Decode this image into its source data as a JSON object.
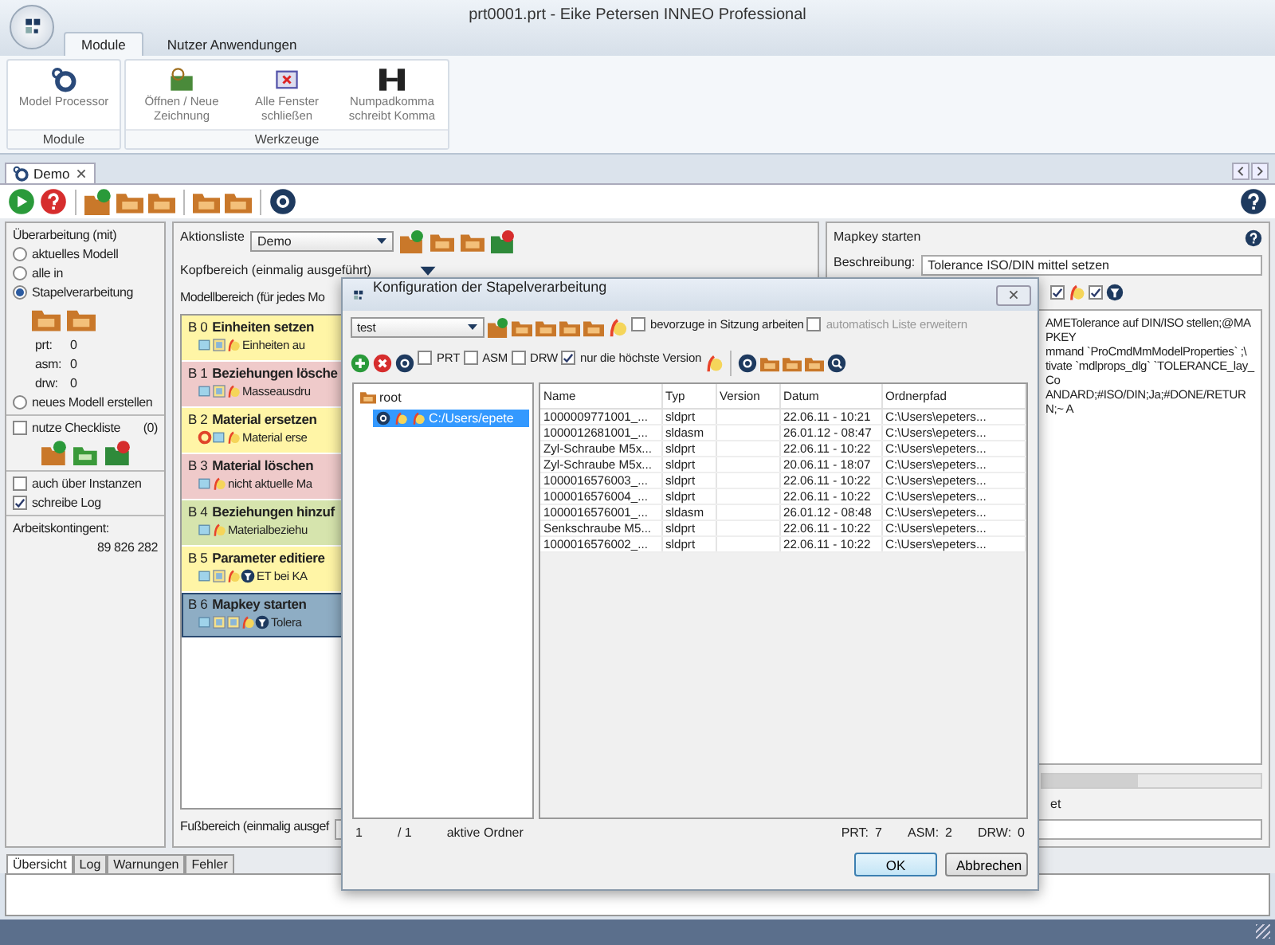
{
  "window": {
    "title": "prt0001.prt - Eike Petersen INNEO Professional"
  },
  "ribbon": {
    "tabs": [
      {
        "label": "Module",
        "selected": true
      },
      {
        "label": "Nutzer Anwendungen",
        "selected": false
      }
    ],
    "groups": [
      {
        "label": "Module",
        "buttons": [
          {
            "label": "Model Processor"
          }
        ]
      },
      {
        "label": "Werkzeuge",
        "buttons": [
          {
            "label": "Öffnen / Neue Zeichnung"
          },
          {
            "label": "Alle Fenster schließen"
          },
          {
            "label": "Numpadkomma schreibt Komma"
          }
        ]
      }
    ]
  },
  "document_tabs": [
    {
      "label": "Demo",
      "selected": true
    }
  ],
  "left_panel": {
    "heading": "Überarbeitung (mit)",
    "options": [
      {
        "label": "aktuelles Modell",
        "selected": false
      },
      {
        "label": "alle in",
        "selected": false
      },
      {
        "label": "Stapelverarbeitung",
        "selected": true
      },
      {
        "label": "neues Modell erstellen",
        "selected": false
      }
    ],
    "counts": [
      {
        "label": "prt:",
        "value": "0"
      },
      {
        "label": "asm:",
        "value": "0"
      },
      {
        "label": "drw:",
        "value": "0"
      }
    ],
    "checklist": {
      "label": "nutze Checkliste",
      "checked": false,
      "count": "(0)"
    },
    "checks": [
      {
        "label": "auch über Instanzen",
        "checked": false
      },
      {
        "label": "schreibe Log",
        "checked": true
      }
    ],
    "quota": {
      "label": "Arbeitskontingent:",
      "value": "89 826 282"
    }
  },
  "center": {
    "action_list": {
      "label": "Aktionsliste",
      "value": "Demo"
    },
    "header_section": "Kopfbereich (einmalig ausgeführt)",
    "model_section": "Modellbereich (für jedes Mo",
    "blocks": [
      {
        "id": "B 0",
        "title": "Einheiten setzen",
        "action": "Einheiten au",
        "color": "#fff5a6",
        "selected": false
      },
      {
        "id": "B 1",
        "title": "Beziehungen lösche",
        "action": "Masseausdru",
        "color": "#efcaca",
        "selected": false
      },
      {
        "id": "B 2",
        "title": "Material ersetzen",
        "action": "Material erse",
        "color": "#fff5a6",
        "selected": false
      },
      {
        "id": "B 3",
        "title": "Material löschen",
        "action": "nicht aktuelle Ma",
        "color": "#efcaca",
        "selected": false
      },
      {
        "id": "B 4",
        "title": "Beziehungen hinzuf",
        "action": "Materialbeziehu",
        "color": "#d6e4ad",
        "selected": false
      },
      {
        "id": "B 5",
        "title": "Parameter editiere",
        "action": "ET bei KA",
        "color": "#fff5a6",
        "selected": false
      },
      {
        "id": "B 6",
        "title": "Mapkey starten",
        "action": "Tolera",
        "color": "#8eadc4",
        "selected": true
      }
    ],
    "footer_section": "Fußbereich (einmalig ausgef"
  },
  "right_panel": {
    "title": "Mapkey starten",
    "description": {
      "label": "Beschreibung:",
      "value": "Tolerance ISO/DIN mittel setzen"
    },
    "options": [
      {
        "checked": true
      },
      {
        "checked": true
      }
    ],
    "mapkey_lines": [
      "AMETolerance auf DIN/ISO stellen;@MAPKEY",
      "mmand `ProCmdMmModelProperties` ;\\",
      "tivate `mdlprops_dlg` `TOLERANCE_lay_Co",
      "ANDARD;#ISO/DIN;Ja;#DONE/RETURN;~ A"
    ],
    "footer_label": "et"
  },
  "dialog": {
    "title": "Konfiguration der Stapelverarbeitung",
    "list_value": "test",
    "options": [
      {
        "label": "bevorzuge in Sitzung arbeiten",
        "checked": false,
        "disabled": false
      },
      {
        "label": "automatisch Liste erweitern",
        "checked": false,
        "disabled": true
      }
    ],
    "filters": [
      {
        "label": "PRT",
        "checked": false
      },
      {
        "label": "ASM",
        "checked": false
      },
      {
        "label": "DRW",
        "checked": false
      },
      {
        "label": "nur die höchste Version",
        "checked": true
      }
    ],
    "tree": [
      {
        "label": "root",
        "selected": false,
        "children": [
          {
            "label": "C:/Users/epete",
            "selected": true
          }
        ]
      }
    ],
    "table": {
      "columns": [
        "Name",
        "Typ",
        "Version",
        "Datum",
        "Ordnerpfad"
      ],
      "rows": [
        [
          "1000009771001_...",
          "sldprt",
          "",
          "22.06.11 - 10:21",
          "C:\\Users\\epeters..."
        ],
        [
          "1000012681001_...",
          "sldasm",
          "",
          "26.01.12 - 08:47",
          "C:\\Users\\epeters..."
        ],
        [
          "Zyl-Schraube M5x...",
          "sldprt",
          "",
          "22.06.11 - 10:22",
          "C:\\Users\\epeters..."
        ],
        [
          "Zyl-Schraube M5x...",
          "sldprt",
          "",
          "20.06.11 - 18:07",
          "C:\\Users\\epeters..."
        ],
        [
          "1000016576003_...",
          "sldprt",
          "",
          "22.06.11 - 10:22",
          "C:\\Users\\epeters..."
        ],
        [
          "1000016576004_...",
          "sldprt",
          "",
          "22.06.11 - 10:22",
          "C:\\Users\\epeters..."
        ],
        [
          "1000016576001_...",
          "sldasm",
          "",
          "26.01.12 - 08:48",
          "C:\\Users\\epeters..."
        ],
        [
          "Senkschraube M5...",
          "sldprt",
          "",
          "22.06.11 - 10:22",
          "C:\\Users\\epeters..."
        ],
        [
          "1000016576002_...",
          "sldprt",
          "",
          "22.06.11 - 10:22",
          "C:\\Users\\epeters..."
        ]
      ]
    },
    "status": {
      "page": "1",
      "pages": "/ 1",
      "folders": "aktive Ordner",
      "counts": [
        {
          "label": "PRT:",
          "value": "7"
        },
        {
          "label": "ASM:",
          "value": "2"
        },
        {
          "label": "DRW:",
          "value": "0"
        }
      ]
    },
    "buttons": [
      {
        "label": "OK",
        "kind": "default"
      },
      {
        "label": "Abbrechen",
        "kind": "normal"
      }
    ]
  },
  "bottom_tabs": [
    {
      "label": "Übersicht",
      "selected": true
    },
    {
      "label": "Log",
      "selected": false
    },
    {
      "label": "Warnungen",
      "selected": false
    },
    {
      "label": "Fehler",
      "selected": false
    }
  ]
}
